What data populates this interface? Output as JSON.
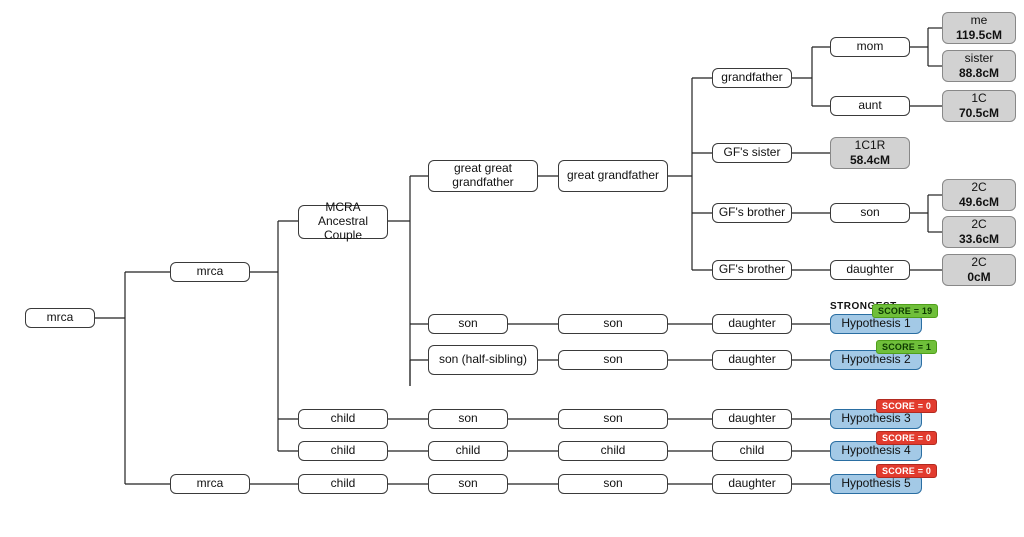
{
  "labels": {
    "strongest": "STRONGEST"
  },
  "colors": {
    "node_border": "#3a3a3a",
    "shaded_bg": "#d2d2d2",
    "hypothesis_bg": "#a3c9e6",
    "badge_green": "#6fbf3a",
    "badge_red": "#e23b2e"
  },
  "tree": {
    "root": {
      "label": "mrca"
    },
    "mrca_upper": {
      "label": "mrca"
    },
    "mrca_lower": {
      "label": "mrca"
    },
    "mcra_couple": {
      "label": "MCRA Ancestral Couple"
    },
    "gg_grandfather": {
      "label": "great great grandfather"
    },
    "g_grandfather": {
      "label": "great grandfather"
    },
    "grandfather": {
      "label": "grandfather"
    },
    "mom": {
      "label": "mom"
    },
    "aunt": {
      "label": "aunt"
    },
    "gf_sister": {
      "label": "GF's sister"
    },
    "gf_brother_a": {
      "label": "GF's brother"
    },
    "gf_brother_a_son": {
      "label": "son"
    },
    "gf_brother_b": {
      "label": "GF's brother"
    },
    "gf_brother_b_daughter": {
      "label": "daughter"
    }
  },
  "matches": {
    "me": {
      "rel": "me",
      "cm": "119.5cM"
    },
    "sister": {
      "rel": "sister",
      "cm": "88.8cM"
    },
    "one_c": {
      "rel": "1C",
      "cm": "70.5cM"
    },
    "one_c1r": {
      "rel": "1C1R",
      "cm": "58.4cM"
    },
    "two_c_a": {
      "rel": "2C",
      "cm": "49.6cM"
    },
    "two_c_b": {
      "rel": "2C",
      "cm": "33.6cM"
    },
    "two_c_c": {
      "rel": "2C",
      "cm": "0cM"
    }
  },
  "hypotheses": [
    {
      "label": "Hypothesis 1",
      "score": 19,
      "score_text": "SCORE = 19",
      "strongest": true,
      "chain": [
        "son",
        "son",
        "daughter"
      ]
    },
    {
      "label": "Hypothesis 2",
      "score": 1,
      "score_text": "SCORE = 1",
      "chain": [
        "son (half-sibling)",
        "son",
        "daughter"
      ]
    },
    {
      "label": "Hypothesis 3",
      "score": 0,
      "score_text": "SCORE = 0",
      "chain": [
        "child",
        "son",
        "son",
        "daughter"
      ]
    },
    {
      "label": "Hypothesis 4",
      "score": 0,
      "score_text": "SCORE = 0",
      "chain": [
        "child",
        "child",
        "child",
        "child"
      ]
    },
    {
      "label": "Hypothesis 5",
      "score": 0,
      "score_text": "SCORE = 0",
      "chain": [
        "child",
        "son",
        "son",
        "daughter"
      ]
    }
  ]
}
